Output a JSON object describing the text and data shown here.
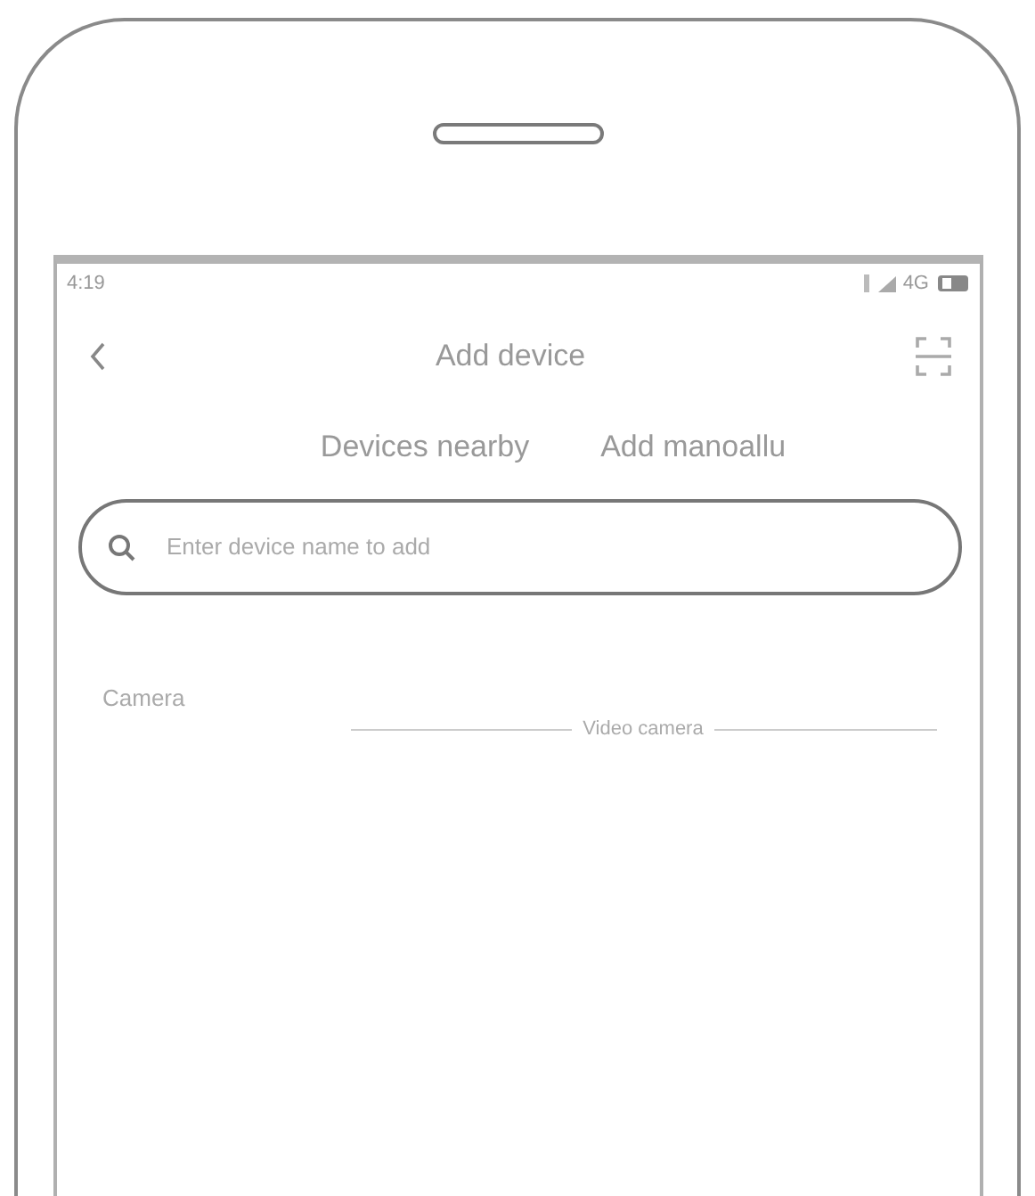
{
  "status_bar": {
    "time": "4:19",
    "network": "4G"
  },
  "header": {
    "title": "Add device"
  },
  "tabs": [
    {
      "label": "Devices nearby",
      "selected": false
    },
    {
      "label": "Add manoallu",
      "selected": false
    }
  ],
  "search": {
    "placeholder": "Enter device name to add"
  },
  "category": {
    "label": "Camera",
    "section": "Video camera"
  }
}
